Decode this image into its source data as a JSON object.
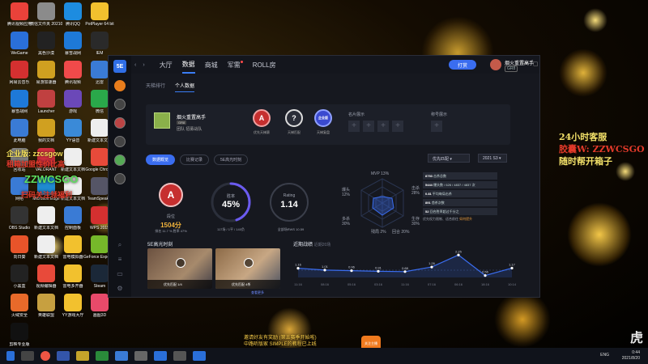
{
  "desktop": {
    "icons": [
      {
        "label": "腾讯视频应用"
      },
      {
        "label": "微信文件夹 2021072"
      },
      {
        "label": "腾讯QQ"
      },
      {
        "label": "PotPlayer 64 bit"
      },
      {
        "label": "WeGame"
      },
      {
        "label": "黑色沙漠"
      },
      {
        "label": "暴雪战网"
      },
      {
        "label": "IEM"
      },
      {
        "label": "网易云音乐"
      },
      {
        "label": "易游加速器"
      },
      {
        "label": "腾讯视频"
      },
      {
        "label": "迅雷"
      },
      {
        "label": "暴雪战网"
      },
      {
        "label": "Launcher"
      },
      {
        "label": "游戏"
      },
      {
        "label": "微信"
      },
      {
        "label": "此电脑"
      },
      {
        "label": "我的文档"
      },
      {
        "label": "YY语音"
      },
      {
        "label": "新建文本文档"
      },
      {
        "label": "回收站"
      },
      {
        "label": "VALORANT"
      },
      {
        "label": "新建文本文档"
      },
      {
        "label": "Google Chrome"
      },
      {
        "label": "网络"
      },
      {
        "label": "Microsoft Edge"
      },
      {
        "label": "新建文本文档"
      },
      {
        "label": "TeamSpeak 3"
      },
      {
        "label": "OBS Studio"
      },
      {
        "label": "新建文本文档"
      },
      {
        "label": "控制面板"
      },
      {
        "label": "WPS 2019"
      },
      {
        "label": "向日葵"
      },
      {
        "label": "新建文本文档"
      },
      {
        "label": "雷电模拟器"
      },
      {
        "label": "GeForce Experience"
      },
      {
        "label": "小黑盒"
      },
      {
        "label": "视频编辑器"
      },
      {
        "label": "雷电多开器"
      },
      {
        "label": "Steam"
      },
      {
        "label": "火绒安全"
      },
      {
        "label": "英雄联盟"
      },
      {
        "label": "YY游戏大厅"
      },
      {
        "label": "画图3D"
      },
      {
        "label": "剪映专业版"
      }
    ],
    "overlay": {
      "line1": "企业版: zzcsgow",
      "line2": "租箱加盟性价比高",
      "line3": "ZZWCSGO",
      "line4": "扫码关注领福利"
    }
  },
  "promo": {
    "line1": "24小时客服",
    "line2": "胶囊W: ZZWCSGO",
    "line3": "随时帮开箱子"
  },
  "app": {
    "logo": "5E",
    "nav": {
      "back": "‹",
      "forward": "›"
    },
    "tabs": [
      {
        "label": "大厅"
      },
      {
        "label": "数据"
      },
      {
        "label": "商城"
      },
      {
        "label": "军需"
      },
      {
        "label": "ROLL房"
      }
    ],
    "pill_label": "打赏",
    "user": {
      "name": "烟火重置高手",
      "badge": "GR8"
    },
    "window_controls": {
      "min": "—",
      "max": "▢",
      "close": "✕"
    },
    "subtabs": [
      {
        "label": "天梯排行"
      },
      {
        "label": "个人数据"
      }
    ],
    "profile": {
      "name": "烟火重置高手",
      "level": "GR8",
      "team_label": "团队",
      "team_value": "招募战队",
      "rank_current": "A",
      "rank_current_label": "优先天梯赛",
      "rank_unknown": "?",
      "rank_unknown_label": "天梯匹配",
      "rank_plus": "企业版",
      "rank_plus_label": "天梯复盘",
      "slots_left_label": "名片展示",
      "slots_right_label": "称号展示",
      "slot_plus": "+"
    },
    "filters": {
      "buttons": [
        {
          "label": "数据概览"
        },
        {
          "label": "比赛记录"
        },
        {
          "label": "5E高光时刻"
        }
      ],
      "dropdown_mode": "优先匹配",
      "dropdown_season": "2021 S3"
    },
    "stats": {
      "rank_letter": "A",
      "rank_label": "段位",
      "elo": "1504分",
      "elo_note": "排名 11.7 % 胜率 47%",
      "winrate_label": "胜率",
      "winrate_value": "45%",
      "winrate_note": "117场 / 1平 / 140负",
      "rating_label": "Rating",
      "rating_value": "1.14",
      "rating_note": "全部场RWS 10.59"
    },
    "radar": {
      "labels": [
        {
          "name": "MVP",
          "value": "13%"
        },
        {
          "name": "爆头",
          "value": "12%"
        },
        {
          "name": "击杀",
          "value": "28%"
        },
        {
          "name": "多杀",
          "value": "30%"
        },
        {
          "name": "生存",
          "value": "30%"
        },
        {
          "name": "残局",
          "value": "2%"
        },
        {
          "name": "回合",
          "value": "20%"
        }
      ]
    },
    "bars": {
      "rows": [
        {
          "value": "8753",
          "label": "击杀总数"
        },
        {
          "value": "5444",
          "label": "爆头数 / 626 / 4837 / 4837 次"
        },
        {
          "value": "0.81",
          "label": "平均每局击杀"
        },
        {
          "value": "891",
          "label": "首杀次数"
        },
        {
          "value": "52",
          "label": "回合胜率超过千分之"
        }
      ],
      "foot": "优先权力限制、适合前往",
      "foot_highlight": "如何提升"
    },
    "highlights": {
      "title": "5E高光时刻",
      "clips": [
        {
          "caption": "优先匹配",
          "count": "1/4"
        },
        {
          "caption": "优先匹配",
          "count": "4杀"
        }
      ],
      "more": "查看更多"
    },
    "trend": {
      "title": "近期战绩",
      "subtitle": "近期20场"
    },
    "chart_data": {
      "type": "line",
      "x": [
        "11:16",
        "08:16",
        "05:16",
        "03:16",
        "11:16",
        "07:16",
        "06:16",
        "18:16",
        "10:14"
      ],
      "y": [
        1.16,
        1.01,
        0.96,
        0.91,
        0.88,
        1.26,
        2.25,
        0.56,
        1.17
      ],
      "labels": [
        "1.16",
        "1.01",
        "0.96",
        "0.91",
        "0.88",
        "1.26",
        "2.25",
        "0.56",
        "1.17"
      ]
    }
  },
  "ticker": {
    "line1": "邀请好友有奖励 (第五赛季开始啦)",
    "line2": "中路听版家 SIMPLE的教程已上线",
    "logo": "关注主播"
  },
  "taskbar": {
    "lang": "ENG",
    "time": "0:44",
    "date": "2021/8/20"
  },
  "watermark": "虎"
}
